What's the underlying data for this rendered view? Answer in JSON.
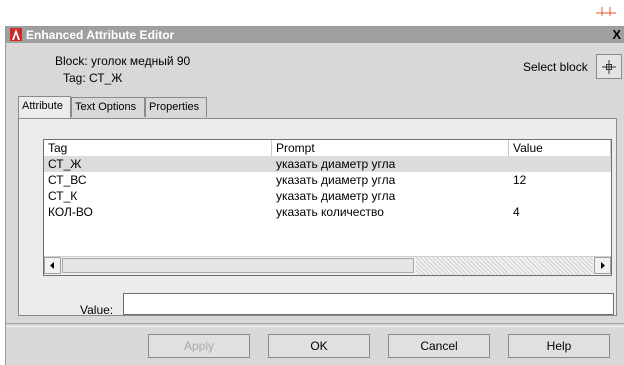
{
  "window": {
    "title": "Enhanced Attribute Editor",
    "close_glyph": "X"
  },
  "header": {
    "block_label": "Block: уголок медный 90",
    "tag_label": "Tag: СТ_Ж",
    "select_block_label": "Select block"
  },
  "tabs": [
    {
      "label": "Attribute",
      "active": true
    },
    {
      "label": "Text Options",
      "active": false
    },
    {
      "label": "Properties",
      "active": false
    }
  ],
  "table": {
    "columns": [
      "Tag",
      "Prompt",
      "Value"
    ],
    "rows": [
      {
        "tag": "СТ_Ж",
        "prompt": "указать диаметр угла",
        "value": "",
        "selected": true
      },
      {
        "tag": "СТ_ВС",
        "prompt": "указать диаметр угла",
        "value": "12",
        "selected": false
      },
      {
        "tag": "СТ_К",
        "prompt": "указать диаметр угла",
        "value": "",
        "selected": false
      },
      {
        "tag": "КОЛ-ВО",
        "prompt": "указать количество",
        "value": "4",
        "selected": false
      }
    ]
  },
  "value_field": {
    "label": "Value:",
    "value": ""
  },
  "buttons": {
    "apply": "Apply",
    "ok": "OK",
    "cancel": "Cancel",
    "help": "Help"
  },
  "icons": {
    "app": "autocad-app-icon",
    "select_block": "crosshair-pick-icon",
    "close": "close-icon"
  },
  "colors": {
    "titlebar": "#9f9f9f",
    "app_icon_red": "#d1282a",
    "selected_row": "#dcdcdc"
  }
}
